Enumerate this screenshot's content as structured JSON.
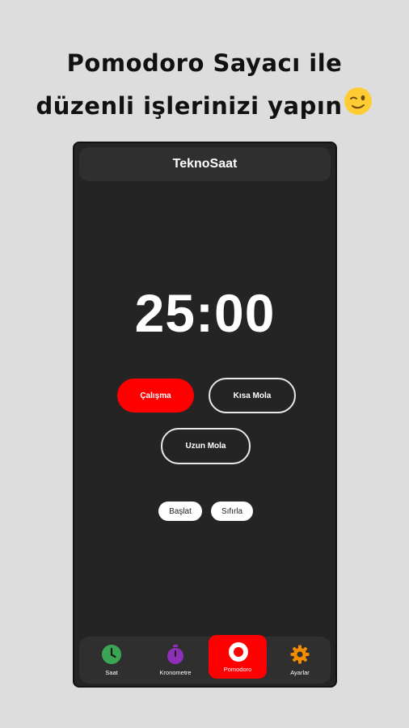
{
  "promo": {
    "line1": "Pomodoro Sayacı ile",
    "line2": "düzenli işlerinizi yapın"
  },
  "app": {
    "title": "TeknoSaat",
    "timer": "25:00",
    "modes": {
      "work": "Çalışma",
      "short_break": "Kısa Mola",
      "long_break": "Uzun Mola",
      "active": "work"
    },
    "controls": {
      "start": "Başlat",
      "reset": "Sıfırla"
    }
  },
  "nav": {
    "items": [
      {
        "label": "Saat",
        "icon": "clock-icon",
        "color": "#3aa655"
      },
      {
        "label": "Kronometre",
        "icon": "stopwatch-icon",
        "color": "#8e2fb8"
      },
      {
        "label": "Pomodoro",
        "icon": "pomodoro-icon",
        "color": "#ffffff"
      },
      {
        "label": "Ayarlar",
        "icon": "gear-icon",
        "color": "#f28c00"
      }
    ],
    "active": "Pomodoro"
  },
  "colors": {
    "accent": "#ff0000",
    "background": "#242424",
    "page": "#dddddd"
  }
}
